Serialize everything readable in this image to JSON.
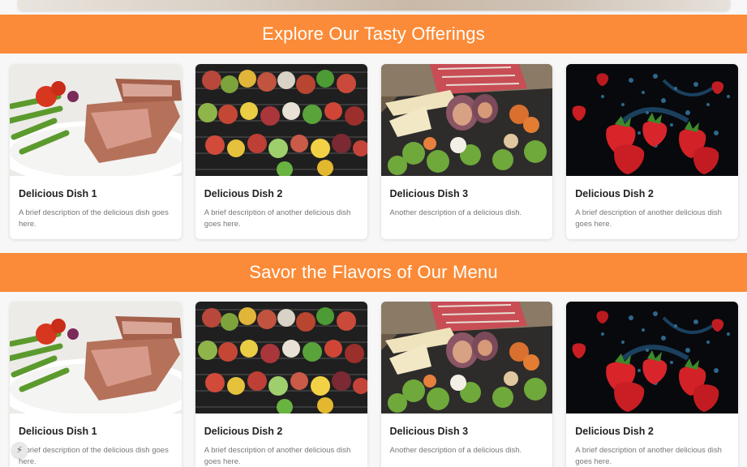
{
  "sections": [
    {
      "title": "Explore Our Tasty Offerings",
      "cards": [
        {
          "title": "Delicious Dish 1",
          "description": "A brief description of the delicious dish goes here.",
          "image": "steak-asparagus"
        },
        {
          "title": "Delicious Dish 2",
          "description": "A brief description of another delicious dish goes here.",
          "image": "grilled-skewers"
        },
        {
          "title": "Delicious Dish 3",
          "description": "Another description of a delicious dish.",
          "image": "cheese-fig-platter"
        },
        {
          "title": "Delicious Dish 2",
          "description": "A brief description of another delicious dish goes here.",
          "image": "strawberries-splash"
        }
      ]
    },
    {
      "title": "Savor the Flavors of Our Menu",
      "cards": [
        {
          "title": "Delicious Dish 1",
          "description": "A brief description of the delicious dish goes here.",
          "image": "steak-asparagus"
        },
        {
          "title": "Delicious Dish 2",
          "description": "A brief description of another delicious dish goes here.",
          "image": "grilled-skewers"
        },
        {
          "title": "Delicious Dish 3",
          "description": "Another description of a delicious dish.",
          "image": "cheese-fig-platter"
        },
        {
          "title": "Delicious Dish 2",
          "description": "A brief description of another delicious dish goes here.",
          "image": "strawberries-splash"
        }
      ]
    }
  ],
  "floating_button": {
    "icon": "lightning-icon"
  },
  "colors": {
    "banner": "#fb8b38",
    "banner_text": "#ffffff",
    "background": "#f7f7f7"
  }
}
